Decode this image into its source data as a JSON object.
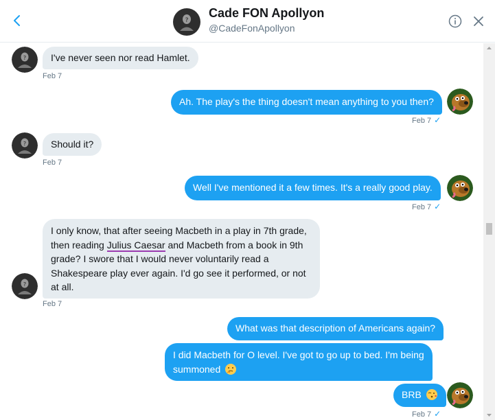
{
  "header": {
    "name": "Cade FON Apollyon",
    "handle": "@CadeFonApollyon"
  },
  "messages": [
    {
      "from": "them",
      "text": "I've never seen nor read Hamlet.",
      "time": "Feb 7"
    },
    {
      "from": "me",
      "text": "Ah. The play's the thing doesn't mean anything to you then?",
      "time": "Feb 7"
    },
    {
      "from": "them",
      "text": "Should it?",
      "time": "Feb 7"
    },
    {
      "from": "me",
      "text": "Well I've mentioned it a few times. It's a really good play.",
      "time": "Feb 7"
    },
    {
      "from": "them",
      "lines": [
        "I only know, that after seeing Macbeth in a play in 7th grade,",
        "then reading",
        "Julius Caesar",
        "and Macbeth from a book in 9th",
        "grade? I swore that I would never voluntarily read a",
        "Shakespeare play ever again. I'd go see it performed, or not",
        "at all."
      ],
      "time": "Feb 7"
    },
    {
      "from": "me",
      "text": "What was that description of Americans again?"
    },
    {
      "from": "me",
      "lines": [
        "I did Macbeth for O level. I've got to go up to bed. I'm being",
        "summoned"
      ],
      "emoji": "thinking-face-icon"
    },
    {
      "from": "me",
      "text": "BRB",
      "emoji": "kissing-face-icon",
      "time": "Feb 7"
    }
  ],
  "read_mark": "✓",
  "colors": {
    "sent_bubble": "#1da1f2",
    "received_bubble": "#e6ecf0",
    "underline": "#9b3bb0"
  }
}
